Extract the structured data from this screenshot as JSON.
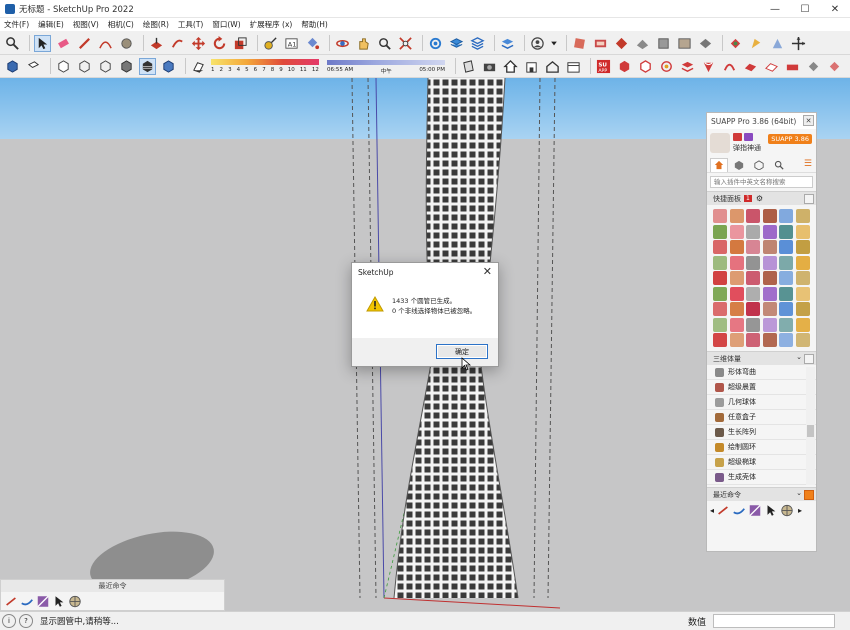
{
  "window": {
    "title": "无标题 - SketchUp Pro 2022",
    "controls": [
      "—",
      "☐",
      "✕"
    ]
  },
  "menu": [
    "文件(F)",
    "编辑(E)",
    "视图(V)",
    "相机(C)",
    "绘图(R)",
    "工具(T)",
    "窗口(W)",
    "扩展程序 (x)",
    "帮助(H)"
  ],
  "toolbar_shadow": {
    "scale": [
      "1",
      "2",
      "3",
      "4",
      "5",
      "6",
      "7",
      "8",
      "9",
      "10",
      "11",
      "12"
    ],
    "time_start": "06:55 AM",
    "time_mid": "中午",
    "time_end": "05:00 PM"
  },
  "dialog": {
    "title": "SketchUp",
    "close": "✕",
    "line1": "1433 个圆管已生成。",
    "line2": "0 个非线选择物体已被忽略。",
    "ok_label": "确定"
  },
  "suapp": {
    "title": "SUAPP Pro 3.86 (64bit)",
    "badge": "SUAPP 3.86",
    "username": "弹指神通",
    "search_placeholder": "输入插件中英文名称搜索",
    "quick_panel": "快捷面板",
    "quick_badge": "1",
    "section_3d": "三维体量",
    "items": [
      {
        "label": "形体弯曲",
        "color": "#8a8a8a"
      },
      {
        "label": "超级晨置",
        "color": "#b0564a"
      },
      {
        "label": "几何球体",
        "color": "#9c9c9c"
      },
      {
        "label": "任意盒子",
        "color": "#a26a3a"
      },
      {
        "label": "生长阵列",
        "color": "#6c5a4a"
      },
      {
        "label": "绘制圆环",
        "color": "#c48a2a"
      },
      {
        "label": "超级椭球",
        "color": "#c7a24a"
      },
      {
        "label": "生成壳体",
        "color": "#7a5a8a"
      }
    ],
    "recent": "最近命令"
  },
  "mini_tray": {
    "title": "最近命令"
  },
  "status": {
    "text": "显示圆管中,请稍等...",
    "measure_label": "数值"
  },
  "colors": {
    "sky_top": "#6db3e8",
    "ground": "#c6c6c7",
    "accent": "#2c72c7",
    "suapp_orange": "#f0801a"
  }
}
